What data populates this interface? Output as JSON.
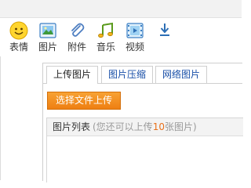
{
  "toolbar": {
    "items": [
      {
        "label": "表情",
        "icon": "smiley-icon"
      },
      {
        "label": "图片",
        "icon": "picture-icon"
      },
      {
        "label": "附件",
        "icon": "paperclip-icon"
      },
      {
        "label": "音乐",
        "icon": "music-note-icon"
      },
      {
        "label": "视频",
        "icon": "video-film-icon"
      }
    ],
    "download_icon": "download-arrow-icon"
  },
  "upload_panel": {
    "tabs": [
      {
        "label": "上传图片",
        "active": true
      },
      {
        "label": "图片压缩",
        "active": false
      },
      {
        "label": "网络图片",
        "active": false
      }
    ],
    "choose_button": "选择文件上传",
    "list": {
      "title": "图片列表",
      "hint_prefix": "(您还可以上传",
      "hint_count": "10",
      "hint_suffix": "张图片)"
    }
  },
  "colors": {
    "link_blue": "#1a50a8",
    "button_orange": "#f08a1e",
    "count_orange": "#e8711c",
    "hint_gray": "#999999"
  }
}
